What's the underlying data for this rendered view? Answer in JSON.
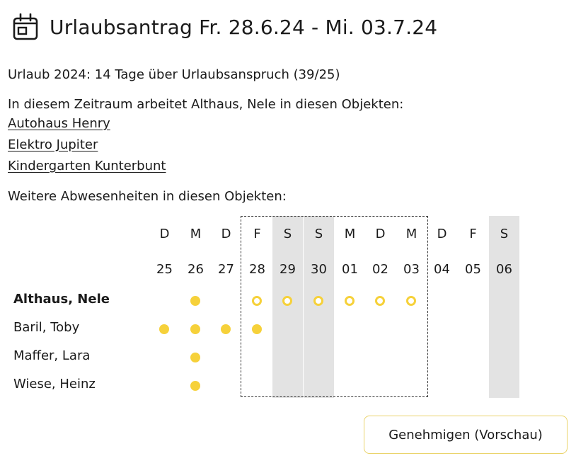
{
  "header": {
    "icon": "calendar-icon",
    "title": "Urlaubsantrag Fr. 28.6.24 - Mi. 03.7.24"
  },
  "summary": "Urlaub 2024: 14 Tage über Urlaubsanspruch (39/25)",
  "objects_intro": "In diesem Zeitraum arbeitet Althaus, Nele in diesen Objekten:",
  "objects": [
    "Autohaus Henry",
    "Elektro Jupiter",
    "Kindergarten Kunterbunt"
  ],
  "absences_intro": "Weitere Abwesenheiten in diesen Objekten:",
  "calendar": {
    "days": [
      {
        "weekday": "D",
        "date": "25",
        "weekend": false
      },
      {
        "weekday": "M",
        "date": "26",
        "weekend": false
      },
      {
        "weekday": "D",
        "date": "27",
        "weekend": false
      },
      {
        "weekday": "F",
        "date": "28",
        "weekend": false
      },
      {
        "weekday": "S",
        "date": "29",
        "weekend": true
      },
      {
        "weekday": "S",
        "date": "30",
        "weekend": true
      },
      {
        "weekday": "M",
        "date": "01",
        "weekend": false
      },
      {
        "weekday": "D",
        "date": "02",
        "weekend": false
      },
      {
        "weekday": "M",
        "date": "03",
        "weekend": false
      },
      {
        "weekday": "D",
        "date": "04",
        "weekend": false
      },
      {
        "weekday": "F",
        "date": "05",
        "weekend": false
      },
      {
        "weekday": "S",
        "date": "06",
        "weekend": true
      }
    ],
    "requested_range": [
      "28",
      "03"
    ],
    "employees": [
      {
        "name": "Althaus, Nele",
        "bold": true,
        "absences": {
          "26": "approved",
          "28": "requested",
          "29": "requested",
          "30": "requested",
          "01": "requested",
          "02": "requested",
          "03": "requested"
        }
      },
      {
        "name": "Baril, Toby",
        "bold": false,
        "absences": {
          "25": "approved",
          "26": "approved",
          "27": "approved",
          "28": "approved"
        }
      },
      {
        "name": "Maffer, Lara",
        "bold": false,
        "absences": {
          "26": "approved"
        }
      },
      {
        "name": "Wiese, Heinz",
        "bold": false,
        "absences": {
          "26": "approved"
        }
      }
    ],
    "colors": {
      "absence": "#f6d13a",
      "weekend": "#e3e3e3",
      "range_border": "#333333"
    }
  },
  "actions": {
    "approve_preview_label": "Genehmigen (Vorschau)",
    "button_border": "#ead36a"
  }
}
